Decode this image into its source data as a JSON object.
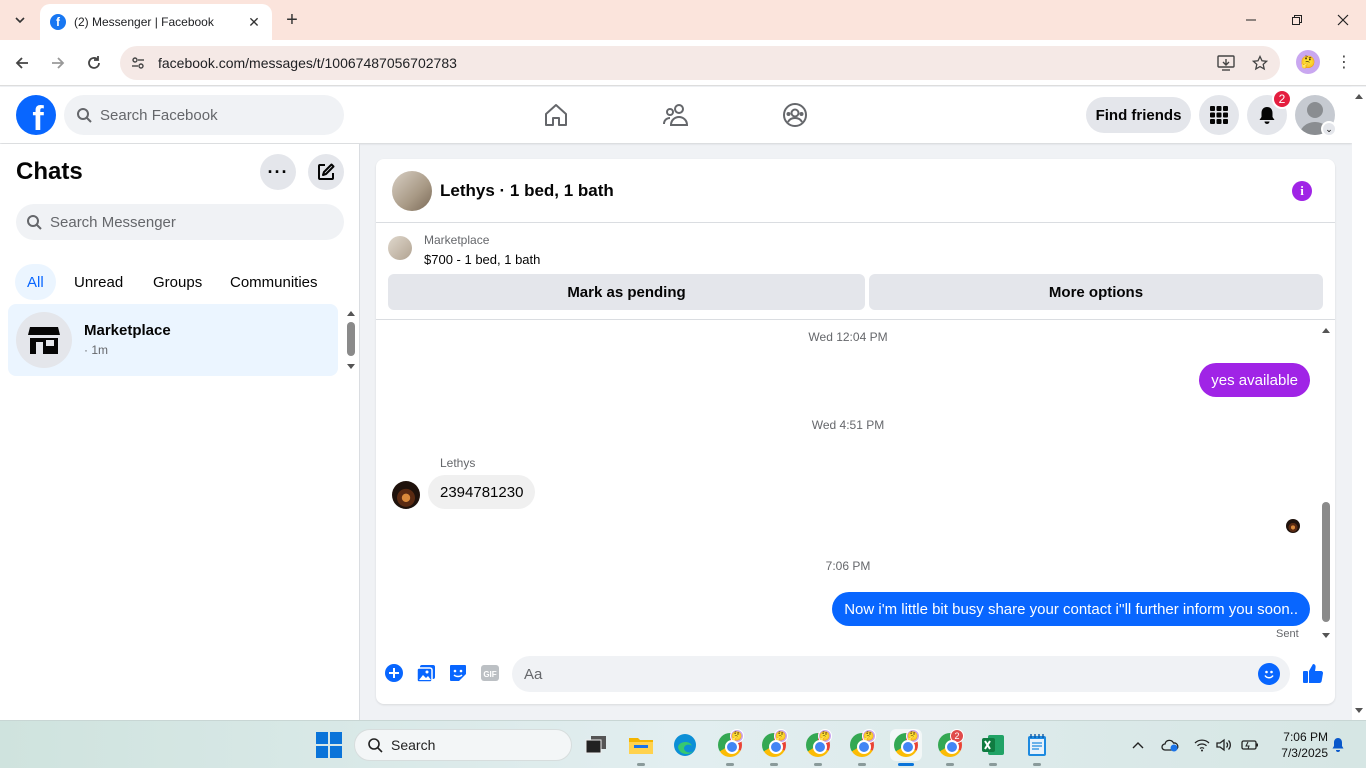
{
  "browser": {
    "tab_title": "(2) Messenger | Facebook",
    "url": "facebook.com/messages/t/10067487056702783"
  },
  "fb_header": {
    "search_placeholder": "Search Facebook",
    "find_friends": "Find friends",
    "notification_count": "2"
  },
  "chats": {
    "title": "Chats",
    "search_placeholder": "Search Messenger",
    "filters": [
      "All",
      "Unread",
      "Groups",
      "Communities"
    ],
    "active_filter": "All",
    "items": [
      {
        "name": "Marketplace",
        "meta": "· 1m"
      }
    ]
  },
  "conversation": {
    "title": "Lethys · 1 bed, 1 bath",
    "marketplace": {
      "label": "Marketplace",
      "listing": "$700 - 1 bed, 1 bath",
      "mark_pending": "Mark as pending",
      "more_options": "More options"
    },
    "messages": {
      "ts1": "Wed 12:04 PM",
      "out1": "yes available",
      "ts2": "Wed 4:51 PM",
      "sender": "Lethys",
      "in1": "2394781230",
      "ts3": "7:06 PM",
      "out2": "Now i'm little bit busy share your contact i''ll further inform you soon..",
      "status": "Sent"
    },
    "composer_placeholder": "Aa",
    "colors": {
      "purple_bubble": "#a024e6",
      "blue_bubble": "#0866ff"
    }
  },
  "taskbar": {
    "search_label": "Search",
    "time": "7:06 PM",
    "date": "7/3/2025",
    "chrome_badge": "2"
  }
}
